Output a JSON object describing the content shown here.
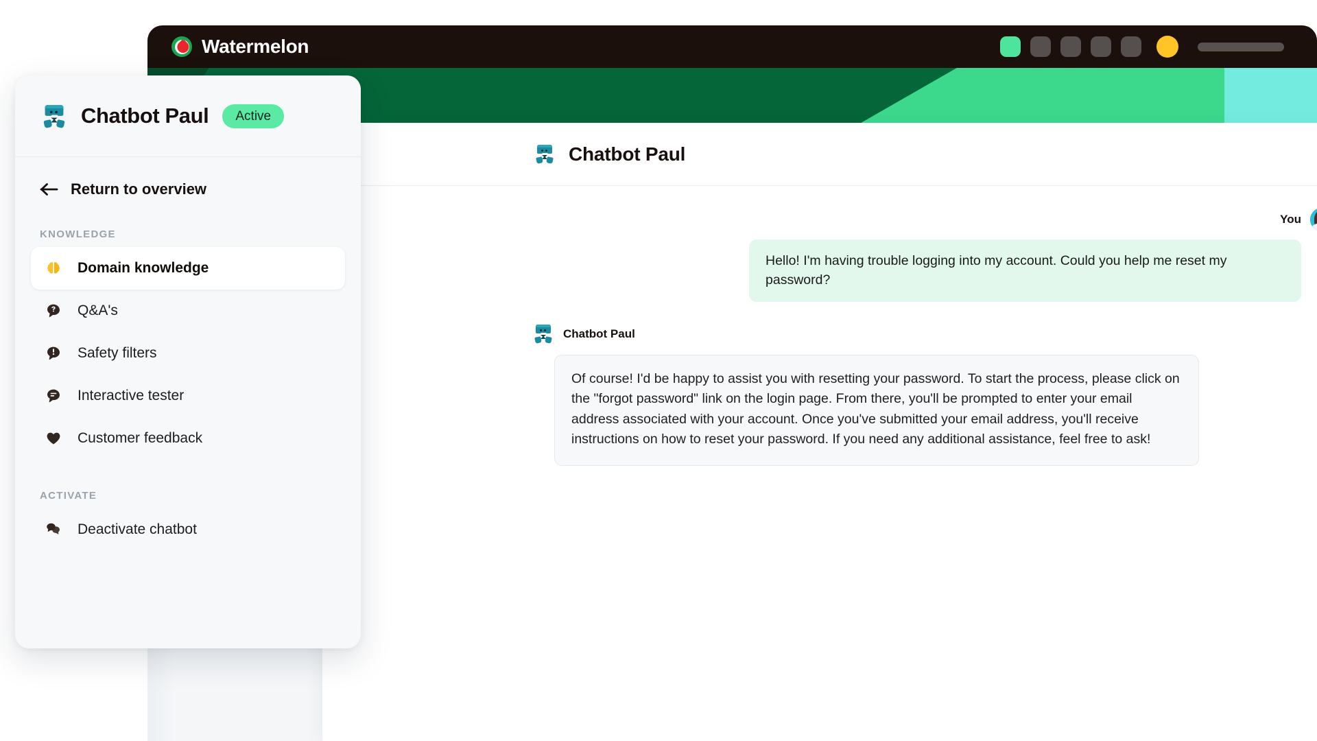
{
  "window": {
    "brand": "Watermelon",
    "brand_logo_icon": "watermelon-logo-icon",
    "controls": [
      {
        "name": "nav-square-active",
        "icon": "square-icon",
        "color": "#4ee49b"
      },
      {
        "name": "nav-square-1",
        "icon": "square-icon",
        "color": "#55504e"
      },
      {
        "name": "nav-square-2",
        "icon": "square-icon",
        "color": "#55504e"
      },
      {
        "name": "nav-square-3",
        "icon": "square-icon",
        "color": "#55504e"
      },
      {
        "name": "nav-square-4",
        "icon": "square-icon",
        "color": "#55504e"
      },
      {
        "name": "account-avatar",
        "icon": "circle-icon",
        "color": "#ffc526"
      },
      {
        "name": "search-pill",
        "icon": "pill-icon",
        "color": "#57524f"
      }
    ]
  },
  "theme": {
    "titlebar_bg": "#1c100c",
    "banner_dark_green": "#056639",
    "banner_green": "#057544",
    "banner_bright_green": "#3cd98d",
    "banner_cyan": "#74ebdf",
    "accent_green": "#5beaa3",
    "user_bubble_bg": "#e3f8ed",
    "bot_bubble_bg": "#f7f8f9",
    "sidebar_bg": "#f6f8f9",
    "brain_icon_color": "#fbc02d"
  },
  "sidebar": {
    "title": "Chatbot Paul",
    "avatar_icon": "robot-avatar-icon",
    "status_badge": "Active",
    "return_label": "Return to overview",
    "return_icon": "arrow-left-icon",
    "sections": [
      {
        "label": "KNOWLEDGE",
        "items": [
          {
            "label": "Domain knowledge",
            "icon": "brain-icon",
            "active": true
          },
          {
            "label": "Q&A's",
            "icon": "question-bubble-icon",
            "active": false
          },
          {
            "label": "Safety filters",
            "icon": "alert-bubble-icon",
            "active": false
          },
          {
            "label": "Interactive tester",
            "icon": "chat-bubble-icon",
            "active": false
          },
          {
            "label": "Customer feedback",
            "icon": "heart-icon",
            "active": false
          }
        ]
      },
      {
        "label": "ACTIVATE",
        "items": [
          {
            "label": "Deactivate chatbot",
            "icon": "chat-bubbles-icon",
            "active": false
          }
        ]
      }
    ]
  },
  "main": {
    "header_title": "Chatbot Paul",
    "header_avatar_icon": "robot-avatar-icon",
    "conversation": [
      {
        "role": "user",
        "name": "You",
        "avatar_icon": "user-photo-avatar",
        "text": "Hello! I'm having trouble logging into my account. Could you help me reset my password?"
      },
      {
        "role": "bot",
        "name": "Chatbot Paul",
        "avatar_icon": "robot-avatar-icon",
        "text": "Of course! I'd be happy to assist you with resetting your password. To start the process, please click on the \"forgot password\" link on the login page. From there, you'll be prompted to enter your email address associated with your account. Once you've submitted your email address, you'll receive instructions on how to reset your password. If you need any additional assistance, feel free to ask!"
      }
    ]
  }
}
